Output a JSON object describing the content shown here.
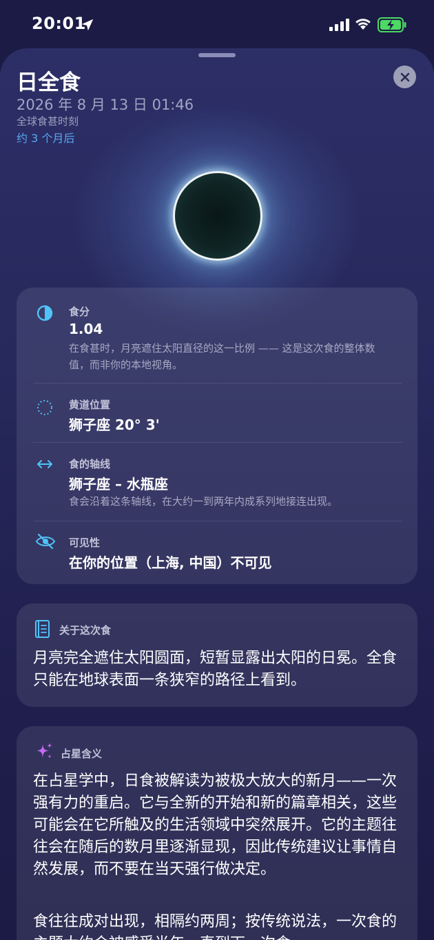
{
  "status_bar": {
    "time": "20:01",
    "accent_battery": "#4cd964"
  },
  "sheet": {
    "title": "日全食",
    "date": "2026 年 8 月 13 日 01:46",
    "subtitle": "全球食甚时刻",
    "relative_time": "约 3 个月后"
  },
  "details": [
    {
      "icon": "half-circle-icon",
      "label": "食分",
      "value": "1.04",
      "description": "在食甚时，月亮遮住太阳直径的这一比例 —— 这是这次食的整体数值，而非你的本地视角。"
    },
    {
      "icon": "dotted-circle-icon",
      "label": "黄道位置",
      "value": "狮子座 20° 3'",
      "description": ""
    },
    {
      "icon": "left-right-arrow-icon",
      "label": "食的轴线",
      "value": "狮子座 – 水瓶座",
      "description": "食会沿着这条轴线，在大约一到两年内成系列地接连出现。"
    },
    {
      "icon": "eye-slash-icon",
      "label": "可见性",
      "value": "在你的位置（上海, 中国）不可见",
      "description": ""
    }
  ],
  "about": {
    "icon": "book-icon",
    "label": "关于这次食",
    "body": "月亮完全遮住太阳圆面，短暂显露出太阳的日冕。全食只能在地球表面一条狭窄的路径上看到。"
  },
  "astrology": {
    "icon": "sparkles-icon",
    "label": "占星含义",
    "paragraph1": "在占星学中，日食被解读为被极大放大的新月——一次强有力的重启。它与全新的开始和新的篇章相关，这些可能会在它所触及的生活领域中突然展开。它的主题往往会在随后的数月里逐渐显现，因此传统建议让事情自然发展，而不要在当天强行做决定。",
    "paragraph2": "食往往成对出现，相隔约两周；按传统说法，一次食的主题大约会被感受半年，直到下一次食"
  },
  "colors": {
    "accent_blue": "#5aa8f5",
    "icon_cyan": "#4fc3f7",
    "sparkle_purple": "#c86bf2"
  }
}
